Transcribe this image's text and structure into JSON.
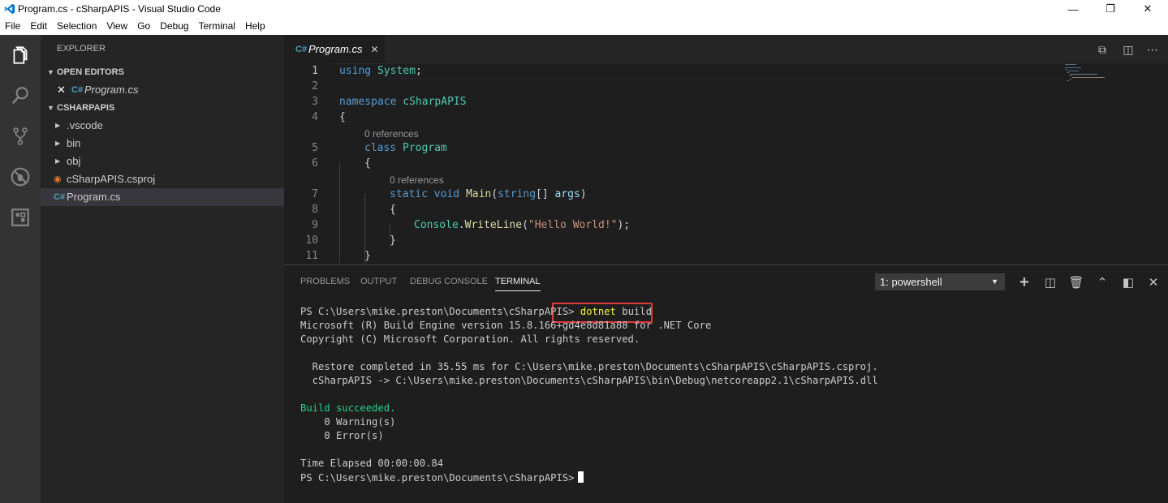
{
  "window": {
    "title": "Program.cs - cSharpAPIS - Visual Studio Code"
  },
  "menu": [
    "File",
    "Edit",
    "Selection",
    "View",
    "Go",
    "Debug",
    "Terminal",
    "Help"
  ],
  "activity_bar": [
    "files-icon",
    "search-icon",
    "source-control-icon",
    "debug-icon",
    "extensions-icon"
  ],
  "sidebar": {
    "header": "EXPLORER",
    "open_editors_label": "OPEN EDITORS",
    "open_editor_file": "Program.cs",
    "project_label": "CSHARPAPIS",
    "items": [
      {
        "label": ".vscode",
        "kind": "folder"
      },
      {
        "label": "bin",
        "kind": "folder"
      },
      {
        "label": "obj",
        "kind": "folder"
      },
      {
        "label": "cSharpAPIS.csproj",
        "kind": "csproj"
      },
      {
        "label": "Program.cs",
        "kind": "cs"
      }
    ]
  },
  "editor": {
    "tab_label": "Program.cs",
    "line_numbers": [
      "1",
      "2",
      "3",
      "4",
      "5",
      "6",
      "7",
      "8",
      "9",
      "10",
      "11"
    ],
    "code_lens": "0 references",
    "code": {
      "l1_kw": "using",
      "l1_ns": "System",
      "l1_end": ";",
      "l3_kw": "namespace",
      "l3_ns": "cSharpAPIS",
      "l4": "{",
      "l5_kw": "class",
      "l5_name": "Program",
      "l6": "{",
      "l7_kw1": "static",
      "l7_kw2": "void",
      "l7_fn": "Main",
      "l7_open": "(",
      "l7_type": "string",
      "l7_arr": "[] ",
      "l7_param": "args",
      "l7_close": ")",
      "l8": "{",
      "l9_obj": "Console",
      "l9_dot": ".",
      "l9_fn": "WriteLine",
      "l9_open": "(",
      "l9_str": "\"Hello World!\"",
      "l9_close": ");",
      "l10": "}",
      "l11": "}"
    }
  },
  "panel": {
    "tabs": [
      "PROBLEMS",
      "OUTPUT",
      "DEBUG CONSOLE",
      "TERMINAL"
    ],
    "active_tab": "TERMINAL",
    "terminal_select": "1: powershell",
    "terminal": {
      "prompt": "PS C:\\Users\\mike.preston\\Documents\\cSharpAPIS>",
      "command_cmd": "dotnet",
      "command_arg": " build",
      "line2": "Microsoft (R) Build Engine version 15.8.166+gd4e8d81a88 for .NET Core",
      "line3": "Copyright (C) Microsoft Corporation. All rights reserved.",
      "line5": "  Restore completed in 35.55 ms for C:\\Users\\mike.preston\\Documents\\cSharpAPIS\\cSharpAPIS.csproj.",
      "line6": "  cSharpAPIS -> C:\\Users\\mike.preston\\Documents\\cSharpAPIS\\bin\\Debug\\netcoreapp2.1\\cSharpAPIS.dll",
      "build_ok": "Build succeeded.",
      "warnings": "    0 Warning(s)",
      "errors": "    0 Error(s)",
      "elapsed": "Time Elapsed 00:00:00.84",
      "final_prompt": "PS C:\\Users\\mike.preston\\Documents\\cSharpAPIS>"
    }
  },
  "colors": {
    "activity": "#333333",
    "sidebar": "#252526",
    "editor": "#1e1e1e",
    "highlight_box": "#e0393c",
    "success": "#23d18b"
  }
}
